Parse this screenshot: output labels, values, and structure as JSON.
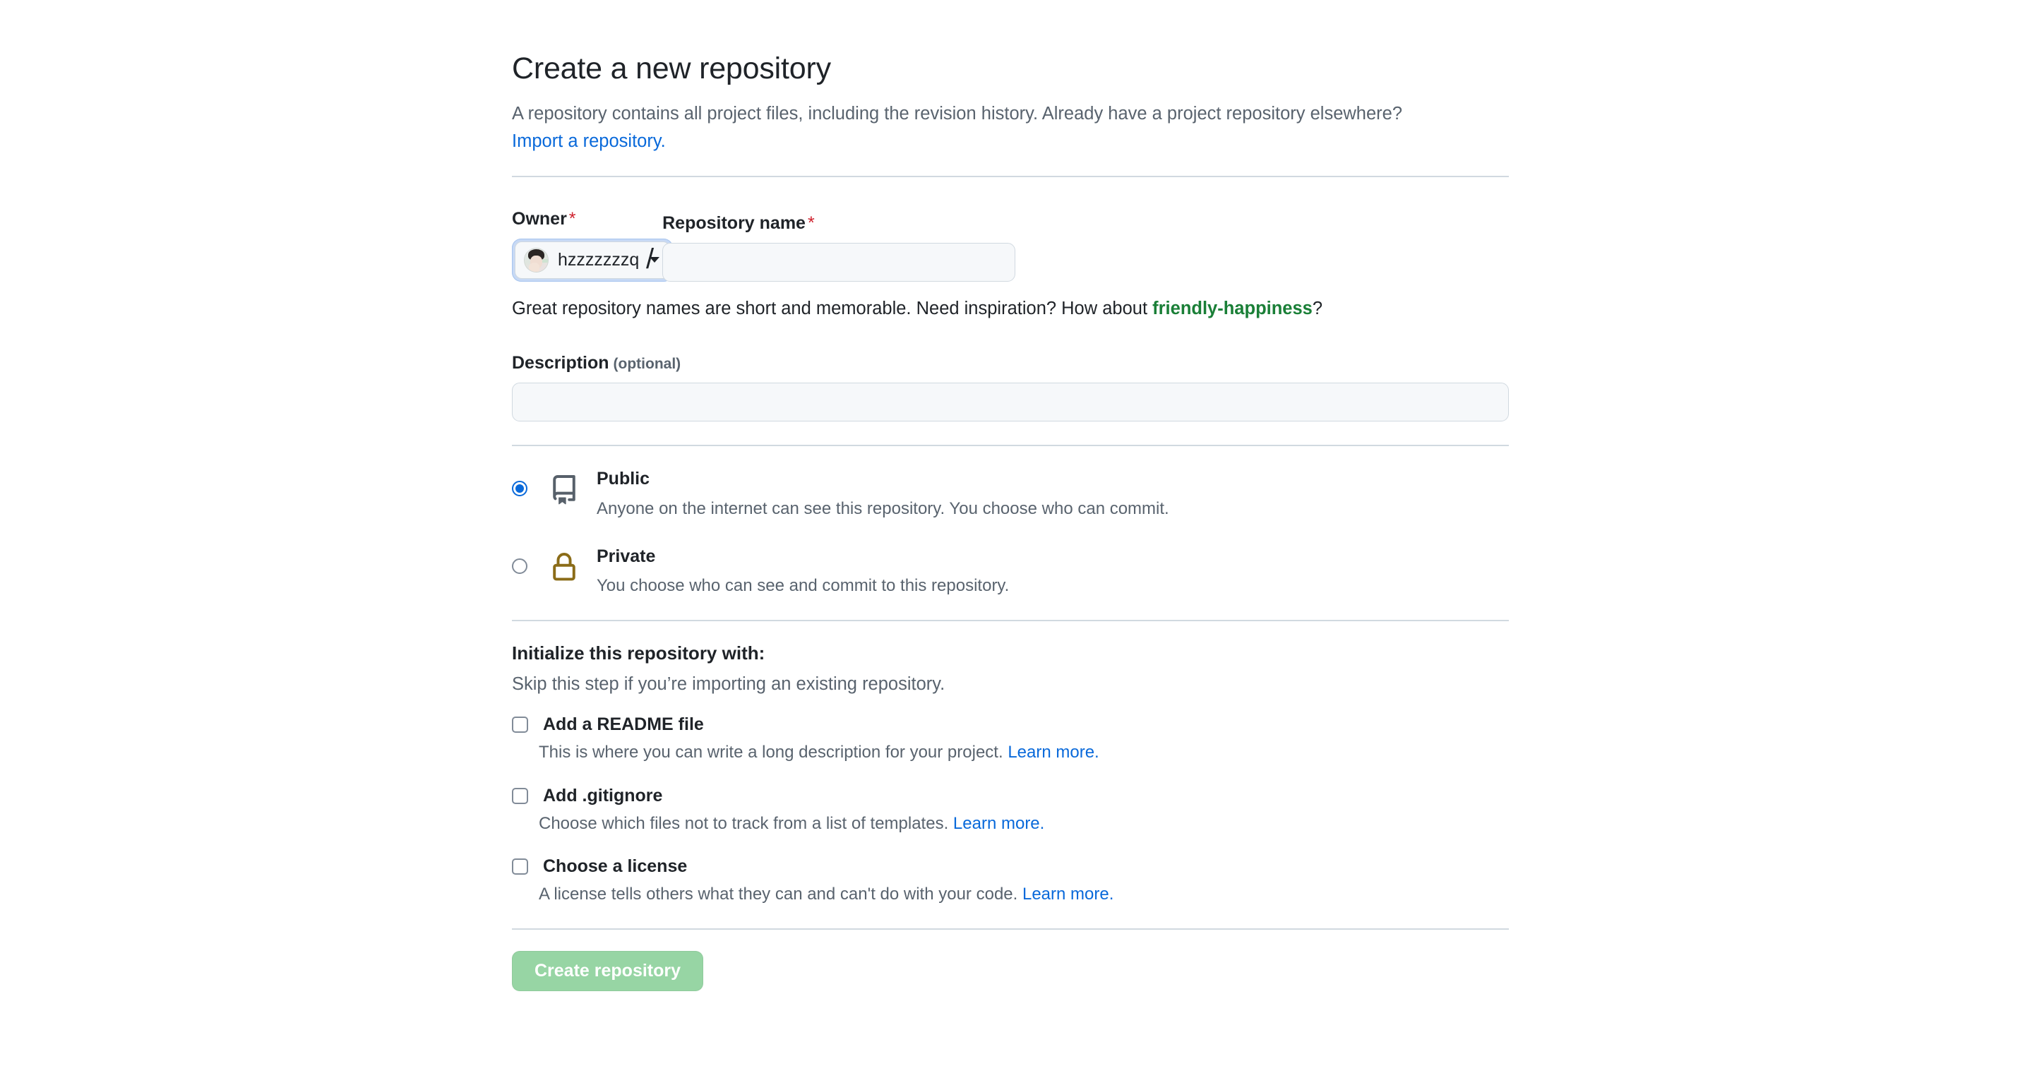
{
  "header": {
    "title": "Create a new repository",
    "subtitle_part1": "A repository contains all project files, including the revision history. Already have a project repository elsewhere? ",
    "import_link": "Import a repository."
  },
  "owner": {
    "label": "Owner",
    "required_mark": "*",
    "selected": "hzzzzzzzq",
    "avatar_icon": "user-avatar-photo",
    "caret_icon": "chevron-down-icon",
    "separator": "/"
  },
  "repo_name": {
    "label": "Repository name",
    "required_mark": "*",
    "value": "",
    "placeholder": ""
  },
  "name_hint": {
    "part1": "Great repository names are short and memorable. Need inspiration? How about ",
    "suggestion": "friendly-happiness",
    "part2": "?"
  },
  "description": {
    "label": "Description",
    "optional_label": "(optional)",
    "value": "",
    "placeholder": ""
  },
  "visibility": {
    "options": [
      {
        "id": "public",
        "title": "Public",
        "description": "Anyone on the internet can see this repository. You choose who can commit.",
        "icon": "repo-book-icon",
        "icon_color": "#57606a",
        "selected": true
      },
      {
        "id": "private",
        "title": "Private",
        "description": "You choose who can see and commit to this repository.",
        "icon": "lock-icon",
        "icon_color": "#8b6c18",
        "selected": false
      }
    ]
  },
  "initialize": {
    "title": "Initialize this repository with:",
    "subtitle": "Skip this step if you’re importing an existing repository.",
    "items": [
      {
        "id": "readme",
        "label": "Add a README file",
        "description": "This is where you can write a long description for your project. ",
        "learn_more": "Learn more.",
        "checked": false
      },
      {
        "id": "gitignore",
        "label": "Add .gitignore",
        "description": "Choose which files not to track from a list of templates. ",
        "learn_more": "Learn more.",
        "checked": false
      },
      {
        "id": "license",
        "label": "Choose a license",
        "description": "A license tells others what they can and can't do with your code. ",
        "learn_more": "Learn more.",
        "checked": false
      }
    ]
  },
  "submit": {
    "label": "Create repository",
    "disabled": true,
    "color": "#97d5a4",
    "text_color": "#ffffff"
  },
  "colors": {
    "link": "#0969da",
    "suggestion_green": "#1a7f37",
    "required_red": "#cf222e",
    "muted_text": "#59636e",
    "body_text": "#1f2328",
    "border": "#d1d9e0",
    "input_bg": "#f6f8fa",
    "focus_ring": "#c7d9f5"
  }
}
